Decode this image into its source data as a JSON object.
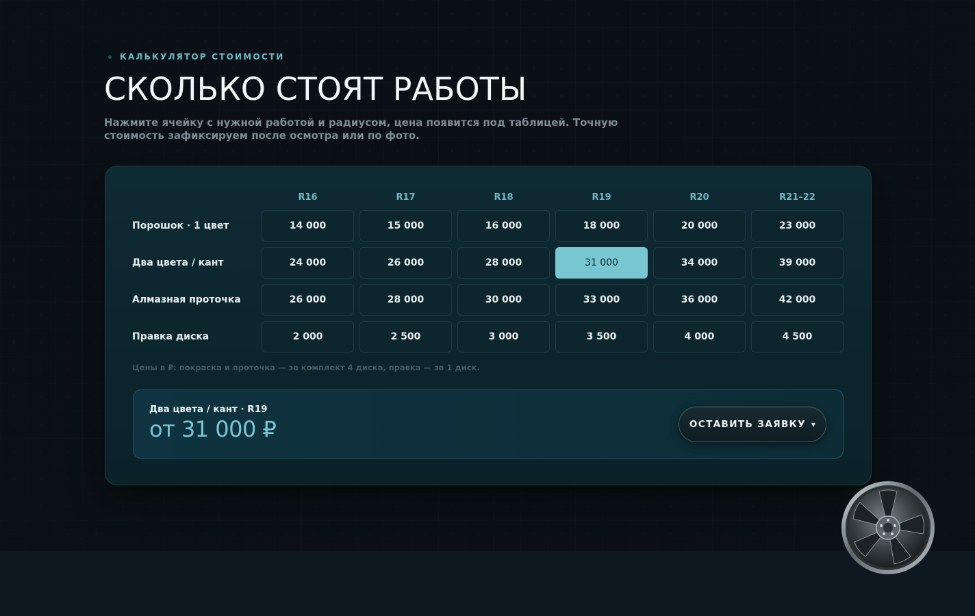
{
  "header": {
    "eyebrow": "КАЛЬКУЛЯТОР СТОИМОСТИ",
    "title": "СКОЛЬКО СТОЯТ РАБОТЫ",
    "subtitle": "Нажмите ячейку с нужной работой и радиусом, цена появится под таблицей. Точную стоимость зафиксируем после осмотра или по фото."
  },
  "table": {
    "columns": [
      "R16",
      "R17",
      "R18",
      "R19",
      "R20",
      "R21–22"
    ],
    "rows": [
      {
        "label": "Порошок · 1 цвет",
        "prices": [
          "14 000",
          "15 000",
          "16 000",
          "18 000",
          "20 000",
          "23 000"
        ]
      },
      {
        "label": "Два цвета / кант",
        "prices": [
          "24 000",
          "26 000",
          "28 000",
          "31 000",
          "34 000",
          "39 000"
        ]
      },
      {
        "label": "Алмазная проточка",
        "prices": [
          "26 000",
          "28 000",
          "30 000",
          "33 000",
          "36 000",
          "42 000"
        ]
      },
      {
        "label": "Правка диска",
        "prices": [
          "2 000",
          "2 500",
          "3 000",
          "3 500",
          "4 000",
          "4 500"
        ]
      }
    ],
    "selected": {
      "row": 1,
      "col": 3
    },
    "note": "Цены в ₽: покраска и проточка — за комплект 4 диска, правка — за 1 диск."
  },
  "result": {
    "label": "Два цвета / кант · R19",
    "price": "от 31 000 ₽"
  },
  "cta": {
    "label": "ОСТАВИТЬ ЗАЯВКУ",
    "arrow": "▼"
  },
  "colors": {
    "accent": "#79c6d3",
    "background": "#0a1117",
    "card": "#0e2a33"
  },
  "icons": {
    "wheel": "wheel-rim-icon"
  }
}
